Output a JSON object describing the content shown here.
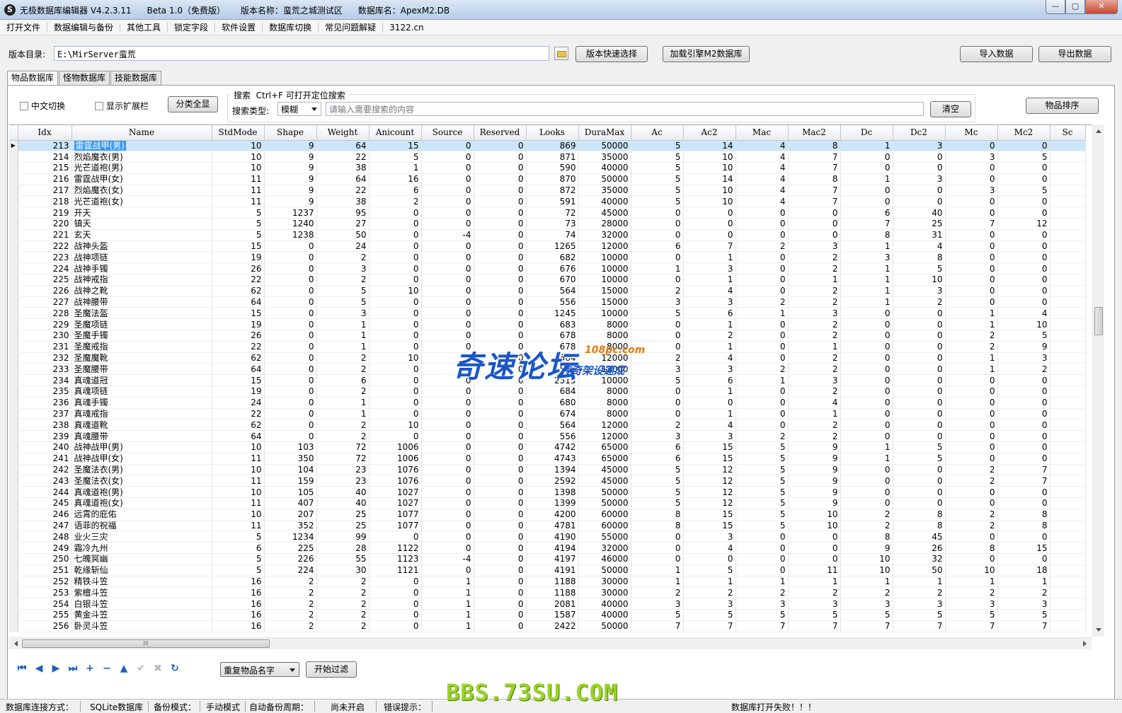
{
  "window": {
    "app_name": "无极数据库编辑器 V4.2.3.11",
    "edition": "Beta 1.0（免费版）",
    "version_name": "版本名称：蛮荒之城测试区",
    "db_name": "数据库名：ApexM2.DB"
  },
  "menu": [
    "打开文件",
    "数据编辑与备份",
    "其他工具",
    "锁定字段",
    "软件设置",
    "数据库切换",
    "常见问题解疑",
    "3122.cn"
  ],
  "path_row": {
    "label": "版本目录:",
    "value": "E:\\MirServer蛮荒",
    "quick_select": "版本快速选择",
    "load_engine": "加载引擎M2数据库",
    "import": "导入数据",
    "export": "导出数据"
  },
  "tabs": [
    "物品数据库",
    "怪物数据库",
    "技能数据库"
  ],
  "toolbar": {
    "chinese_switch": "中文切换",
    "show_ext": "显示扩展栏",
    "category_all": "分类全显",
    "search_title": "搜索  Ctrl+F 可打开定位搜索",
    "search_type_label": "搜索类型:",
    "search_type_value": "模糊",
    "search_placeholder": "请输入需要搜索的内容",
    "clear": "清空",
    "sort": "物品排序"
  },
  "table": {
    "columns": [
      "Idx",
      "Name",
      "StdMode",
      "Shape",
      "Weight",
      "Anicount",
      "Source",
      "Reserved",
      "Looks",
      "DuraMax",
      "Ac",
      "Ac2",
      "Mac",
      "Mac2",
      "Dc",
      "Dc2",
      "Mc",
      "Mc2",
      "Sc"
    ],
    "selected_index": 0,
    "rows": [
      [
        "213",
        "雷霆战甲(男)",
        "10",
        "9",
        "64",
        "15",
        "0",
        "0",
        "869",
        "50000",
        "5",
        "14",
        "4",
        "8",
        "1",
        "3",
        "0",
        "0",
        ""
      ],
      [
        "214",
        "烈焰魔衣(男)",
        "10",
        "9",
        "22",
        "5",
        "0",
        "0",
        "871",
        "35000",
        "5",
        "10",
        "4",
        "7",
        "0",
        "0",
        "3",
        "5",
        ""
      ],
      [
        "215",
        "光芒道袍(男)",
        "10",
        "9",
        "38",
        "1",
        "0",
        "0",
        "590",
        "40000",
        "5",
        "10",
        "4",
        "7",
        "0",
        "0",
        "0",
        "0",
        ""
      ],
      [
        "216",
        "雷霆战甲(女)",
        "11",
        "9",
        "64",
        "16",
        "0",
        "0",
        "870",
        "50000",
        "5",
        "14",
        "4",
        "8",
        "1",
        "3",
        "0",
        "0",
        ""
      ],
      [
        "217",
        "烈焰魔衣(女)",
        "11",
        "9",
        "22",
        "6",
        "0",
        "0",
        "872",
        "35000",
        "5",
        "10",
        "4",
        "7",
        "0",
        "0",
        "3",
        "5",
        ""
      ],
      [
        "218",
        "光芒道袍(女)",
        "11",
        "9",
        "38",
        "2",
        "0",
        "0",
        "591",
        "40000",
        "5",
        "10",
        "4",
        "7",
        "0",
        "0",
        "0",
        "0",
        ""
      ],
      [
        "219",
        "开天",
        "5",
        "1237",
        "95",
        "0",
        "0",
        "0",
        "72",
        "45000",
        "0",
        "0",
        "0",
        "0",
        "6",
        "40",
        "0",
        "0",
        ""
      ],
      [
        "220",
        "镇天",
        "5",
        "1240",
        "27",
        "0",
        "0",
        "0",
        "73",
        "28000",
        "0",
        "0",
        "0",
        "0",
        "7",
        "25",
        "7",
        "12",
        ""
      ],
      [
        "221",
        "玄天",
        "5",
        "1238",
        "50",
        "0",
        "-4",
        "0",
        "74",
        "32000",
        "0",
        "0",
        "0",
        "0",
        "8",
        "31",
        "0",
        "0",
        ""
      ],
      [
        "222",
        "战神头盔",
        "15",
        "0",
        "24",
        "0",
        "0",
        "0",
        "1265",
        "12000",
        "6",
        "7",
        "2",
        "3",
        "1",
        "4",
        "0",
        "0",
        ""
      ],
      [
        "223",
        "战神项链",
        "19",
        "0",
        "2",
        "0",
        "0",
        "0",
        "682",
        "10000",
        "0",
        "1",
        "0",
        "2",
        "3",
        "8",
        "0",
        "0",
        ""
      ],
      [
        "224",
        "战神手镯",
        "26",
        "0",
        "3",
        "0",
        "0",
        "0",
        "676",
        "10000",
        "1",
        "3",
        "0",
        "2",
        "1",
        "5",
        "0",
        "0",
        ""
      ],
      [
        "225",
        "战神戒指",
        "22",
        "0",
        "2",
        "0",
        "0",
        "0",
        "670",
        "10000",
        "0",
        "1",
        "0",
        "1",
        "1",
        "10",
        "0",
        "0",
        ""
      ],
      [
        "226",
        "战神之靴",
        "62",
        "0",
        "5",
        "10",
        "0",
        "0",
        "564",
        "15000",
        "2",
        "4",
        "0",
        "2",
        "1",
        "3",
        "0",
        "0",
        ""
      ],
      [
        "227",
        "战神腰带",
        "64",
        "0",
        "5",
        "0",
        "0",
        "0",
        "556",
        "15000",
        "3",
        "3",
        "2",
        "2",
        "1",
        "2",
        "0",
        "0",
        ""
      ],
      [
        "228",
        "圣魔法盔",
        "15",
        "0",
        "3",
        "0",
        "0",
        "0",
        "1245",
        "10000",
        "5",
        "6",
        "1",
        "3",
        "0",
        "0",
        "1",
        "4",
        ""
      ],
      [
        "229",
        "圣魔项链",
        "19",
        "0",
        "1",
        "0",
        "0",
        "0",
        "683",
        "8000",
        "0",
        "1",
        "0",
        "2",
        "0",
        "0",
        "1",
        "10",
        ""
      ],
      [
        "230",
        "圣魔手镯",
        "26",
        "0",
        "1",
        "0",
        "0",
        "0",
        "678",
        "8000",
        "0",
        "2",
        "0",
        "2",
        "0",
        "0",
        "2",
        "5",
        ""
      ],
      [
        "231",
        "圣魔戒指",
        "22",
        "0",
        "1",
        "0",
        "0",
        "0",
        "678",
        "8000",
        "0",
        "1",
        "0",
        "1",
        "0",
        "0",
        "2",
        "9",
        ""
      ],
      [
        "232",
        "圣魔魔靴",
        "62",
        "0",
        "2",
        "10",
        "0",
        "0",
        "564",
        "12000",
        "2",
        "4",
        "0",
        "2",
        "0",
        "0",
        "1",
        "3",
        ""
      ],
      [
        "233",
        "圣魔腰带",
        "64",
        "0",
        "2",
        "0",
        "0",
        "0",
        "556",
        "12000",
        "3",
        "3",
        "2",
        "2",
        "0",
        "0",
        "1",
        "2",
        ""
      ],
      [
        "234",
        "真魂道冠",
        "15",
        "0",
        "6",
        "0",
        "0",
        "0",
        "2515",
        "10000",
        "5",
        "6",
        "1",
        "3",
        "0",
        "0",
        "0",
        "0",
        ""
      ],
      [
        "235",
        "真魂项链",
        "19",
        "0",
        "2",
        "0",
        "0",
        "0",
        "684",
        "8000",
        "0",
        "1",
        "0",
        "2",
        "0",
        "0",
        "0",
        "0",
        ""
      ],
      [
        "236",
        "真魂手镯",
        "24",
        "0",
        "1",
        "0",
        "0",
        "0",
        "680",
        "8000",
        "0",
        "0",
        "0",
        "4",
        "0",
        "0",
        "0",
        "0",
        ""
      ],
      [
        "237",
        "真魂戒指",
        "22",
        "0",
        "1",
        "0",
        "0",
        "0",
        "674",
        "8000",
        "0",
        "1",
        "0",
        "1",
        "0",
        "0",
        "0",
        "0",
        ""
      ],
      [
        "238",
        "真魂道靴",
        "62",
        "0",
        "2",
        "10",
        "0",
        "0",
        "564",
        "12000",
        "2",
        "4",
        "0",
        "2",
        "0",
        "0",
        "0",
        "0",
        ""
      ],
      [
        "239",
        "真魂腰带",
        "64",
        "0",
        "2",
        "0",
        "0",
        "0",
        "556",
        "12000",
        "3",
        "3",
        "2",
        "2",
        "0",
        "0",
        "0",
        "0",
        ""
      ],
      [
        "240",
        "战神战甲(男)",
        "10",
        "103",
        "72",
        "1006",
        "0",
        "0",
        "4742",
        "65000",
        "6",
        "15",
        "5",
        "9",
        "1",
        "5",
        "0",
        "0",
        ""
      ],
      [
        "241",
        "战神战甲(女)",
        "11",
        "350",
        "72",
        "1006",
        "0",
        "0",
        "4743",
        "65000",
        "6",
        "15",
        "5",
        "9",
        "1",
        "5",
        "0",
        "0",
        ""
      ],
      [
        "242",
        "圣魔法衣(男)",
        "10",
        "104",
        "23",
        "1076",
        "0",
        "0",
        "1394",
        "45000",
        "5",
        "12",
        "5",
        "9",
        "0",
        "0",
        "2",
        "7",
        ""
      ],
      [
        "243",
        "圣魔法衣(女)",
        "11",
        "159",
        "23",
        "1076",
        "0",
        "0",
        "2592",
        "45000",
        "5",
        "12",
        "5",
        "9",
        "0",
        "0",
        "2",
        "7",
        ""
      ],
      [
        "244",
        "真魂道袍(男)",
        "10",
        "105",
        "40",
        "1027",
        "0",
        "0",
        "1398",
        "50000",
        "5",
        "12",
        "5",
        "9",
        "0",
        "0",
        "0",
        "0",
        ""
      ],
      [
        "245",
        "真魂道袍(女)",
        "11",
        "407",
        "40",
        "1027",
        "0",
        "0",
        "1399",
        "50000",
        "5",
        "12",
        "5",
        "9",
        "0",
        "0",
        "0",
        "0",
        ""
      ],
      [
        "246",
        "远霄的庇佑",
        "10",
        "207",
        "25",
        "1077",
        "0",
        "0",
        "4200",
        "60000",
        "8",
        "15",
        "5",
        "10",
        "2",
        "8",
        "2",
        "8",
        ""
      ],
      [
        "247",
        "语菲的祝福",
        "11",
        "352",
        "25",
        "1077",
        "0",
        "0",
        "4781",
        "60000",
        "8",
        "15",
        "5",
        "10",
        "2",
        "8",
        "2",
        "8",
        ""
      ],
      [
        "248",
        "业火三灾",
        "5",
        "1234",
        "99",
        "0",
        "0",
        "0",
        "4190",
        "55000",
        "0",
        "3",
        "0",
        "0",
        "8",
        "45",
        "0",
        "0",
        ""
      ],
      [
        "249",
        "霜冷九州",
        "6",
        "225",
        "28",
        "1122",
        "0",
        "0",
        "4194",
        "32000",
        "0",
        "4",
        "0",
        "0",
        "9",
        "26",
        "8",
        "15",
        ""
      ],
      [
        "250",
        "七魄冥幽",
        "5",
        "226",
        "55",
        "1123",
        "-4",
        "0",
        "4197",
        "46000",
        "0",
        "0",
        "0",
        "0",
        "10",
        "32",
        "0",
        "0",
        ""
      ],
      [
        "251",
        "乾缘斩仙",
        "5",
        "224",
        "30",
        "1121",
        "0",
        "0",
        "4191",
        "50000",
        "1",
        "5",
        "0",
        "11",
        "10",
        "50",
        "10",
        "18",
        ""
      ],
      [
        "252",
        "精铁斗笠",
        "16",
        "2",
        "2",
        "0",
        "1",
        "0",
        "1188",
        "30000",
        "1",
        "1",
        "1",
        "1",
        "1",
        "1",
        "1",
        "1",
        ""
      ],
      [
        "253",
        "紫檀斗笠",
        "16",
        "2",
        "2",
        "0",
        "1",
        "0",
        "1188",
        "30000",
        "2",
        "2",
        "2",
        "2",
        "2",
        "2",
        "2",
        "2",
        ""
      ],
      [
        "254",
        "白银斗笠",
        "16",
        "2",
        "2",
        "0",
        "1",
        "0",
        "2081",
        "40000",
        "3",
        "3",
        "3",
        "3",
        "3",
        "3",
        "3",
        "3",
        ""
      ],
      [
        "255",
        "黄金斗笠",
        "16",
        "2",
        "2",
        "0",
        "1",
        "0",
        "1587",
        "40000",
        "5",
        "5",
        "5",
        "5",
        "5",
        "5",
        "5",
        "5",
        ""
      ],
      [
        "256",
        "卧灵斗笠",
        "16",
        "2",
        "2",
        "0",
        "1",
        "0",
        "2422",
        "50000",
        "7",
        "7",
        "7",
        "7",
        "7",
        "7",
        "7",
        "7",
        ""
      ]
    ]
  },
  "bottom": {
    "filter_value": "重复物品名字",
    "filter_button": "开始过滤",
    "hscroll_grip": "III"
  },
  "watermark": {
    "main": "奇速论坛",
    "site": "108pc.com",
    "sub": "传奇架设速成",
    "bottom": "BBS.73SU.COM"
  },
  "status": {
    "conn_label": "数据库连接方式：",
    "conn_value": "SQLite数据库",
    "backup_label": "备份模式：",
    "backup_value": "手动模式",
    "auto_label": "自动备份周期：",
    "auto_value": "尚未开启",
    "error_label": "错误提示：",
    "error_value": "数据库打开失败！！！"
  }
}
